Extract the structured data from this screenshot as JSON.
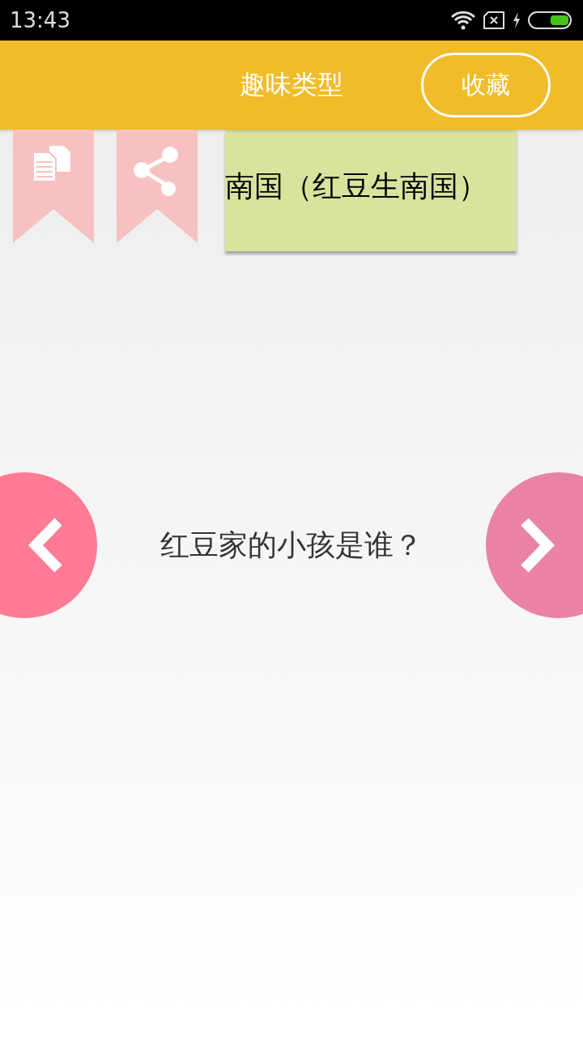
{
  "status_bar": {
    "time": "13:43"
  },
  "header": {
    "title": "趣味类型",
    "favorite_button": "收藏"
  },
  "answer_card": {
    "text": "南国（红豆生南国）"
  },
  "question": {
    "text": "红豆家的小孩是谁？"
  }
}
